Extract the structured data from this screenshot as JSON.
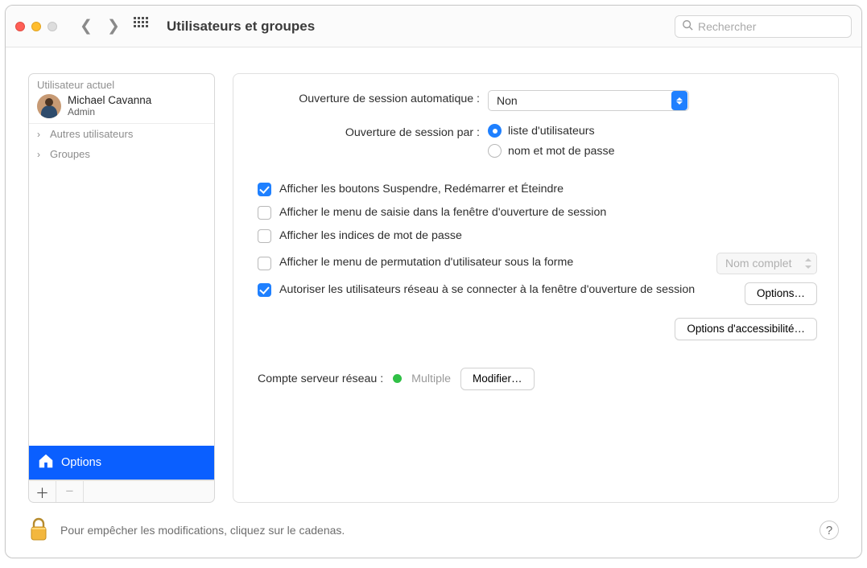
{
  "titlebar": {
    "title": "Utilisateurs et groupes",
    "search_placeholder": "Rechercher"
  },
  "sidebar": {
    "current_user_heading": "Utilisateur actuel",
    "user_name": "Michael Cavanna",
    "user_role": "Admin",
    "rows": {
      "others": "Autres utilisateurs",
      "groups": "Groupes"
    },
    "options_label": "Options"
  },
  "main": {
    "auto_login_label": "Ouverture de session automatique :",
    "auto_login_value": "Non",
    "login_by_label": "Ouverture de session par :",
    "login_by_user_list": "liste d'utilisateurs",
    "login_by_name_pw": "nom et mot de passe",
    "chk_sleep_restart_shutdown": "Afficher les boutons Suspendre, Redémarrer et Éteindre",
    "chk_input_menu": "Afficher le menu de saisie dans la fenêtre d'ouverture de session",
    "chk_password_hints": "Afficher les indices de mot de passe",
    "chk_fast_user_switch": "Afficher le menu de permutation d'utilisateur sous la forme",
    "fast_user_switch_value": "Nom complet",
    "chk_network_users": "Autoriser les utilisateurs réseau à se connecter à la fenêtre d'ouverture de session",
    "options_btn": "Options…",
    "accessibility_btn": "Options d'accessibilité…",
    "network_account_label": "Compte serveur réseau :",
    "network_account_value": "Multiple",
    "edit_btn": "Modifier…"
  },
  "footer": {
    "lock_text": "Pour empêcher les modifications, cliquez sur le cadenas."
  }
}
